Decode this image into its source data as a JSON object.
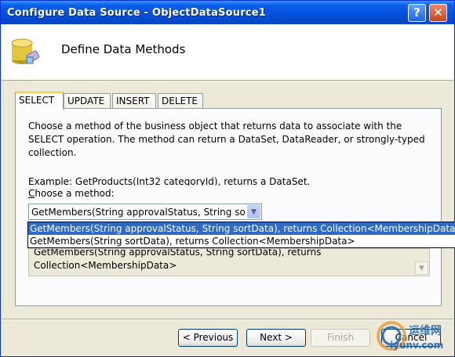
{
  "window": {
    "title": "Configure Data Source - ObjectDataSource1",
    "help_glyph": "?",
    "close_glyph": "✕"
  },
  "header": {
    "heading": "Define Data Methods",
    "icon": "database-icon"
  },
  "tabs": [
    {
      "label": "SELECT",
      "active": true
    },
    {
      "label": "UPDATE"
    },
    {
      "label": "INSERT"
    },
    {
      "label": "DELETE"
    }
  ],
  "select_tab": {
    "description": "Choose a method of the business object that returns data to associate with the SELECT operation. The method can return a DataSet, DataReader, or strongly-typed collection.",
    "example": "Example: GetProducts(Int32 categoryId), returns a DataSet.",
    "choose_label": "Choose a method:",
    "combo_value": "GetMembers(String approvalStatus, String sortData), returns Collection<MembershipData>",
    "signature_box": "GetMembers(String approvalStatus, String sortData), returns Collection<MembershipData>",
    "dropdown_options": [
      "GetMembers(String approvalStatus, String sortData), returns Collection<MembershipData>",
      "GetMembers(String sortData), returns Collection<MembershipData>"
    ]
  },
  "buttons": {
    "previous": "< Previous",
    "next": "Next >",
    "finish": "Finish",
    "cancel": "Cancel"
  },
  "watermark": {
    "line1": "运维网",
    "line2": "iyunv.com"
  }
}
